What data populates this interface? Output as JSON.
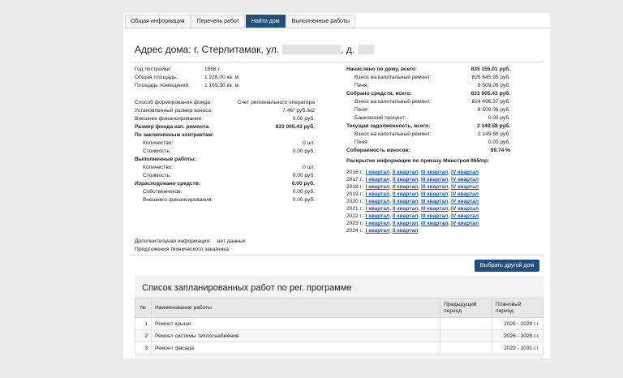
{
  "tabs": [
    {
      "label": "Общая информация",
      "active": false
    },
    {
      "label": "Перечень работ",
      "active": false
    },
    {
      "label": "Найти дом",
      "active": true
    },
    {
      "label": "Выполненные работы",
      "active": false
    }
  ],
  "address": {
    "prefix": "Адрес дома: г. Стерлитамак, ул.",
    "house_prefix": ", д."
  },
  "left": {
    "year_label": "Год постройки:",
    "year_value": "1998 г.",
    "area_label": "Общая площадь:",
    "area_value": "1 226.00 кв. м.",
    "rooms_label": "Площадь помещений:",
    "rooms_value": "1 165.30 кв. м.",
    "method_label": "Способ формирования фонда:",
    "method_value": "Счет регионального оператора",
    "fee_label": "Установленный размер взноса:",
    "fee_value": "7.46* руб./м2",
    "ext_label": "Внешнее финансирование:",
    "ext_value": "0.00 руб.",
    "fund_label": "Размер фонда кап. ремонта:",
    "fund_value": "833 005.43 руб.",
    "contracts_label": "По заключенным контрактам:",
    "c_count_label": "Количество:",
    "c_count_value": "0 шт.",
    "c_cost_label": "Стоимость:",
    "c_cost_value": "0.00 руб.",
    "done_label": "Выполненные работы:",
    "d_count_label": "Количество:",
    "d_count_value": "0 шт.",
    "d_cost_label": "Стоимость:",
    "d_cost_value": "0.00 руб.",
    "spent_label": "Израсходовано средств:",
    "spent_value": "0.00 руб.",
    "own_label": "Собственников:",
    "own_value": "0.00 руб.",
    "sext_label": "Внешнего финансирования:",
    "sext_value": "0.00 руб."
  },
  "right": {
    "charged_label": "Начислено по дому, всего:",
    "charged_value": "835 155.01 руб.",
    "ch_fee_label": "Взнос на капитальный ремонт:",
    "ch_fee_value": "826 645.95 руб.",
    "ch_pen_label": "Пеня:",
    "ch_pen_value": "8 509.06 руб.",
    "collected_label": "Собрано средств, всего:",
    "collected_value": "833 005.43 руб.",
    "co_fee_label": "Взнос на капитальный ремонт:",
    "co_fee_value": "824 496.37 руб.",
    "co_pen_label": "Пеня:",
    "co_pen_value": "8 509.06 руб.",
    "co_bank_label": "Банковский процент:",
    "co_bank_value": "0.00 руб.",
    "debt_label": "Текущая задолженность, всего:",
    "debt_value": "2 149.58 руб.",
    "de_fee_label": "Взнос на капитальный ремонт:",
    "de_fee_value": "2 149.58 руб.",
    "de_pen_label": "Пеня:",
    "de_pen_value": "0.00 руб.",
    "rate_label": "Собираемость взносов:",
    "rate_value": "99.74 %",
    "disclosure_label": "Раскрытие информации по приказу Минстроя 965/пр:"
  },
  "disclosure": [
    {
      "year": "2016 г.:",
      "quarters": [
        "I квартал",
        "II квартал",
        "III квартал",
        "IV квартал"
      ]
    },
    {
      "year": "2017 г.:",
      "quarters": [
        "I квартал",
        "II квартал",
        "III квартал",
        "IV квартал"
      ]
    },
    {
      "year": "2018 г.:",
      "quarters": [
        "I квартал",
        "II квартал",
        "III квартал",
        "IV квартал"
      ]
    },
    {
      "year": "2019 г.:",
      "quarters": [
        "I квартал",
        "II квартал",
        "III квартал",
        "IV квартал"
      ]
    },
    {
      "year": "2020 г.:",
      "quarters": [
        "I квартал",
        "II квартал",
        "III квартал",
        "IV квартал"
      ]
    },
    {
      "year": "2021 г.:",
      "quarters": [
        "I квартал",
        "II квартал",
        "III квартал",
        "IV квартал"
      ]
    },
    {
      "year": "2022 г.:",
      "quarters": [
        "I квартал",
        "II квартал",
        "III квартал",
        "IV квартал"
      ]
    },
    {
      "year": "2023 г.:",
      "quarters": [
        "I квартал",
        "II квартал",
        "III квартал",
        "IV квартал"
      ]
    },
    {
      "year": "2024 г.:",
      "quarters": [
        "I квартал",
        "II квартал"
      ]
    }
  ],
  "extra": {
    "info_label": "Дополнительная информация:",
    "info_value": "нет данных",
    "tech_label": "Предложения технического заказчика:"
  },
  "select_button": "Выбрать другой дом",
  "works": {
    "title": "Список запланированных работ по рег. программе",
    "headers": [
      "№",
      "Наименование работы",
      "Предыдущий период",
      "Плановый период"
    ],
    "rows": [
      {
        "n": "1",
        "name": "Ремонт крыши",
        "prev": "",
        "plan": "2026 - 2028 г.г."
      },
      {
        "n": "2",
        "name": "Ремонт системы теплоснабжения",
        "prev": "",
        "plan": "2026 - 2028 г.г."
      },
      {
        "n": "3",
        "name": "Ремонт фасада",
        "prev": "",
        "plan": "2029 - 2031 г.г."
      }
    ]
  }
}
